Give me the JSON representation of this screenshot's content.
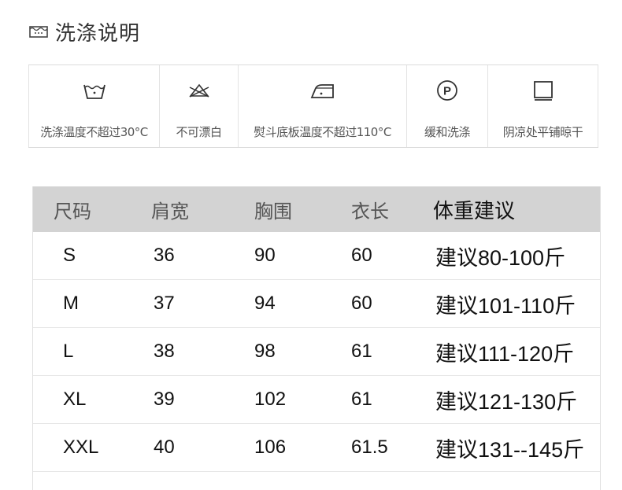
{
  "washing": {
    "title": "洗涤说明",
    "title_icon": "wash-basin-icon",
    "instructions": [
      {
        "icon": "wash-30-icon",
        "label": "洗涤温度不超过30°C"
      },
      {
        "icon": "no-bleach-icon",
        "label": "不可漂白"
      },
      {
        "icon": "iron-low-icon",
        "label": "熨斗底板温度不超过110°C"
      },
      {
        "icon": "dry-clean-p-icon",
        "label": "缓和洗涤"
      },
      {
        "icon": "dry-flat-shade-icon",
        "label": "阴凉处平铺晾干"
      }
    ]
  },
  "size_table": {
    "headers": [
      "尺码",
      "肩宽",
      "胸围",
      "衣长",
      "体重建议"
    ],
    "header_bg": "#d3d3d3",
    "rows": [
      [
        "S",
        "36",
        "90",
        "60",
        "建议80-100斤"
      ],
      [
        "M",
        "37",
        "94",
        "60",
        "建议101-110斤"
      ],
      [
        "L",
        "38",
        "98",
        "61",
        "建议111-120斤"
      ],
      [
        "XL",
        "39",
        "102",
        "61",
        "建议121-130斤"
      ],
      [
        "XXL",
        "40",
        "106",
        "61.5",
        "建议131--145斤"
      ]
    ]
  }
}
